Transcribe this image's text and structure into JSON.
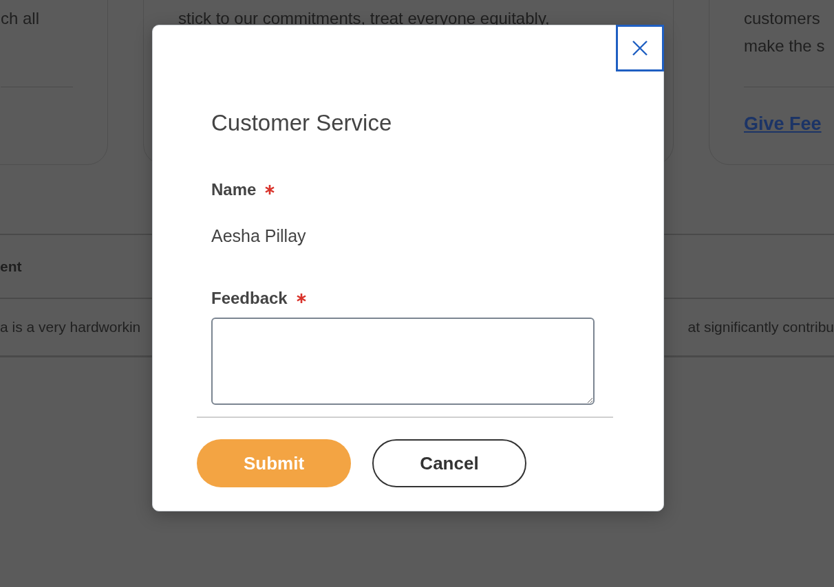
{
  "background": {
    "cards": [
      {
        "lines": [
          "ch all"
        ]
      },
      {
        "lines": [
          "stick to our commitments, treat everyone equitably,"
        ]
      },
      {
        "lines": [
          "customers",
          "make the s"
        ],
        "link": "Give Fee"
      }
    ],
    "table": {
      "header": "ent",
      "row": [
        "a is a very hardworkin",
        "at significantly contribu"
      ]
    }
  },
  "modal": {
    "title": "Customer Service",
    "fields": [
      {
        "label": "Name",
        "required": true,
        "kind": "text",
        "value": "Aesha Pillay"
      },
      {
        "label": "Feedback",
        "required": true,
        "kind": "textarea"
      }
    ],
    "buttons": [
      {
        "label": "Submit",
        "kind": "primary"
      },
      {
        "label": "Cancel",
        "kind": "secondary"
      }
    ]
  }
}
